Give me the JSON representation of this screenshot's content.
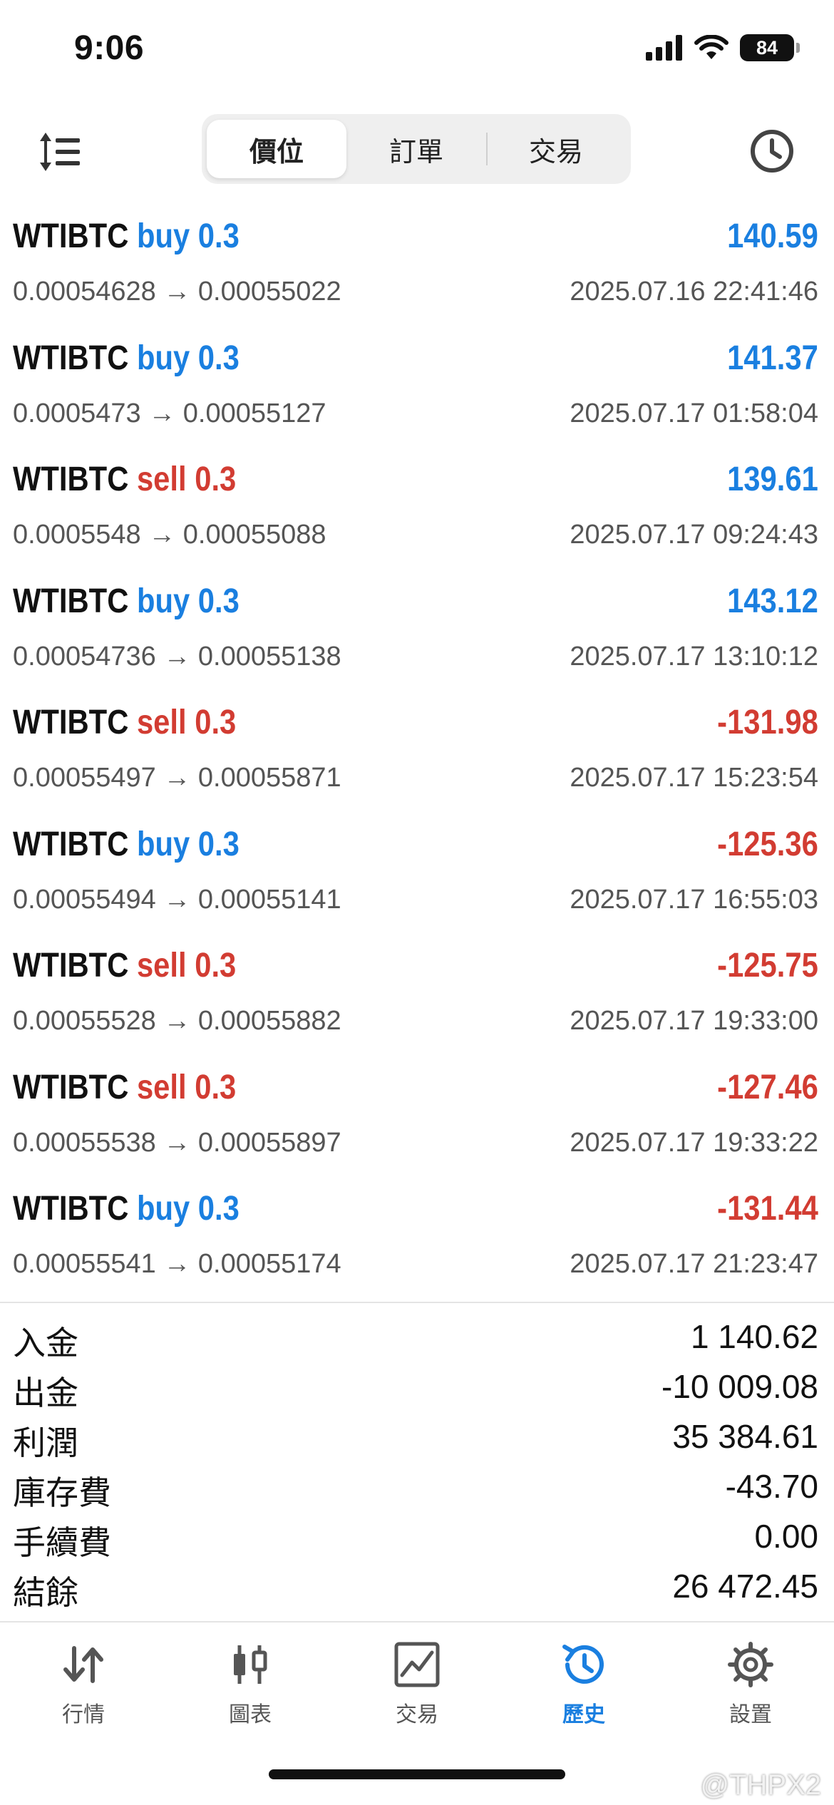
{
  "status_bar": {
    "time": "9:06",
    "battery": "84"
  },
  "top_bar": {
    "segments": [
      {
        "label": "價位",
        "active": true
      },
      {
        "label": "訂單",
        "active": false
      },
      {
        "label": "交易",
        "active": false
      }
    ],
    "sort_icon": "sort-list-icon",
    "clock_icon": "clock-icon"
  },
  "deals": [
    {
      "symbol": "WTIBTC",
      "action": "buy 0.3",
      "side": "buy",
      "open": "0.00054628",
      "arrow": "→",
      "close": "0.00055022",
      "time": "2025.07.16 22:41:46",
      "profit": "140.59"
    },
    {
      "symbol": "WTIBTC",
      "action": "buy 0.3",
      "side": "buy",
      "open": "0.0005473",
      "arrow": "→",
      "close": "0.00055127",
      "time": "2025.07.17 01:58:04",
      "profit": "141.37"
    },
    {
      "symbol": "WTIBTC",
      "action": "sell 0.3",
      "side": "sell",
      "open": "0.0005548",
      "arrow": "→",
      "close": "0.00055088",
      "time": "2025.07.17 09:24:43",
      "profit": "139.61"
    },
    {
      "symbol": "WTIBTC",
      "action": "buy 0.3",
      "side": "buy",
      "open": "0.00054736",
      "arrow": "→",
      "close": "0.00055138",
      "time": "2025.07.17 13:10:12",
      "profit": "143.12"
    },
    {
      "symbol": "WTIBTC",
      "action": "sell 0.3",
      "side": "sell",
      "open": "0.00055497",
      "arrow": "→",
      "close": "0.00055871",
      "time": "2025.07.17 15:23:54",
      "profit": "-131.98"
    },
    {
      "symbol": "WTIBTC",
      "action": "buy 0.3",
      "side": "buy",
      "open": "0.00055494",
      "arrow": "→",
      "close": "0.00055141",
      "time": "2025.07.17 16:55:03",
      "profit": "-125.36"
    },
    {
      "symbol": "WTIBTC",
      "action": "sell 0.3",
      "side": "sell",
      "open": "0.00055528",
      "arrow": "→",
      "close": "0.00055882",
      "time": "2025.07.17 19:33:00",
      "profit": "-125.75"
    },
    {
      "symbol": "WTIBTC",
      "action": "sell 0.3",
      "side": "sell",
      "open": "0.00055538",
      "arrow": "→",
      "close": "0.00055897",
      "time": "2025.07.17 19:33:22",
      "profit": "-127.46"
    },
    {
      "symbol": "WTIBTC",
      "action": "buy 0.3",
      "side": "buy",
      "open": "0.00055541",
      "arrow": "→",
      "close": "0.00055174",
      "time": "2025.07.17 21:23:47",
      "profit": "-131.44"
    }
  ],
  "summary": [
    {
      "label": "入金",
      "value": "1 140.62"
    },
    {
      "label": "出金",
      "value": "-10 009.08"
    },
    {
      "label": "利潤",
      "value": "35 384.61"
    },
    {
      "label": "庫存費",
      "value": "-43.70"
    },
    {
      "label": "手續費",
      "value": "0.00"
    },
    {
      "label": "結餘",
      "value": "26 472.45"
    }
  ],
  "tab_bar": [
    {
      "label": "行情",
      "icon": "quotes-arrows-icon",
      "active": false
    },
    {
      "label": "圖表",
      "icon": "candlestick-chart-icon",
      "active": false
    },
    {
      "label": "交易",
      "icon": "trade-chart-icon",
      "active": false
    },
    {
      "label": "歷史",
      "icon": "history-icon",
      "active": true
    },
    {
      "label": "設置",
      "icon": "settings-gear-icon",
      "active": false
    }
  ],
  "watermark": "@THPX2",
  "colors": {
    "buy_blue": "#1a7fe0",
    "sell_red": "#d23c32",
    "positive_blue": "#1a7fe0",
    "negative_red": "#d23c32"
  }
}
